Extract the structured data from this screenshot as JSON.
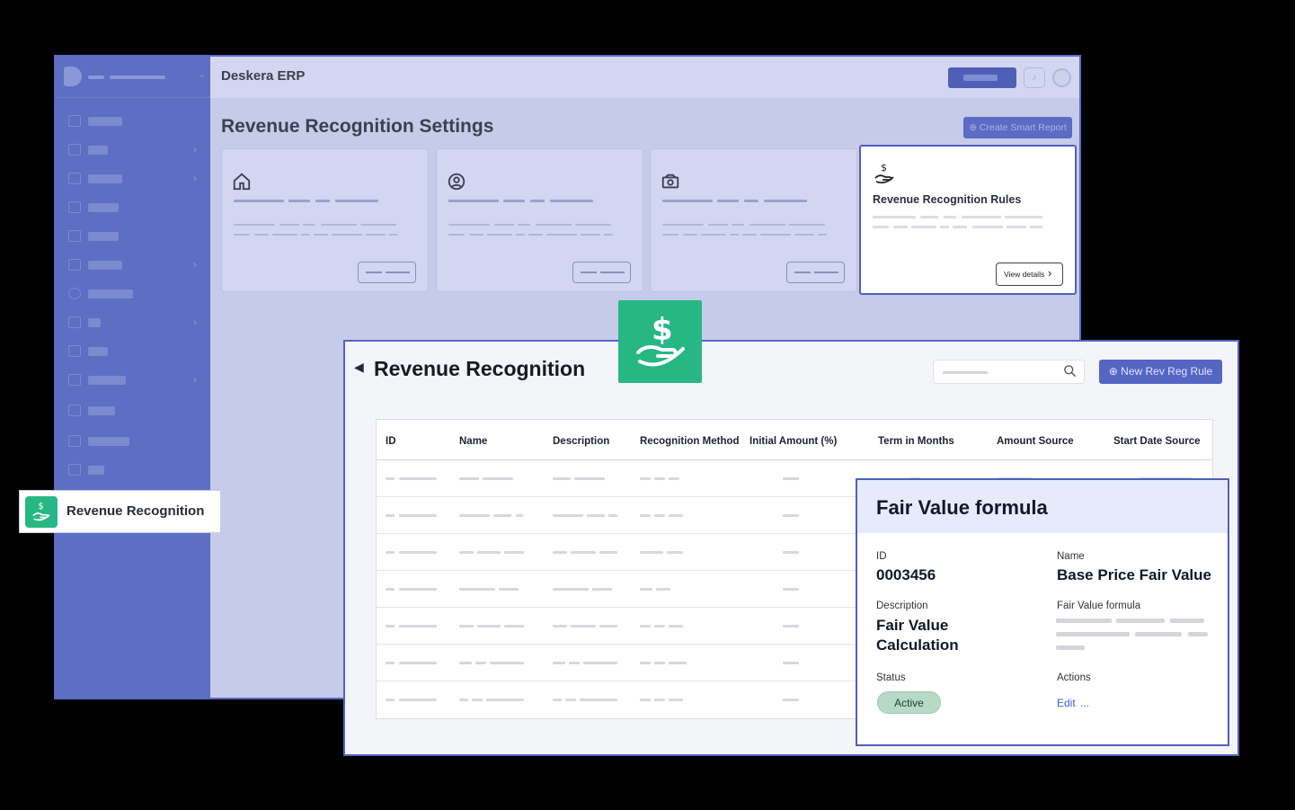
{
  "app": {
    "title": "Deskera ERP"
  },
  "settings": {
    "page_title": "Revenue Recognition Settings",
    "smart_report_label": "⊕ Create Smart Report",
    "active_card": {
      "title": "Revenue Recognition Rules",
      "button_label": "View details"
    }
  },
  "sidebar": {
    "highlighted": {
      "label": "Revenue Recognition"
    }
  },
  "revenue_recognition": {
    "title": "Revenue Recognition",
    "new_rule_label": "⊕  New Rev Reg  Rule",
    "columns": [
      "ID",
      "Name",
      "Description",
      "Recognition Method",
      "Initial Amount (%)",
      "Term in Months",
      "Amount Source",
      "Start Date Source"
    ]
  },
  "fair_value": {
    "title": "Fair Value formula",
    "id_label": "ID",
    "id_value": "0003456",
    "name_label": "Name",
    "name_value": "Base Price Fair Value",
    "description_label": "Description",
    "description_value_line1": "Fair Value",
    "description_value_line2": "Calculation",
    "formula_label": "Fair Value formula",
    "status_label": "Status",
    "status_value": "Active",
    "actions_label": "Actions",
    "edit_label": "Edit",
    "more_label": "..."
  },
  "icons": {
    "home": "home-icon",
    "user": "user-circle-icon",
    "money": "money-icon",
    "revenue": "hand-dollar-icon",
    "search": "search-icon",
    "back": "caret-left-icon",
    "bell": "bell-icon",
    "avatar": "avatar-icon"
  },
  "colors": {
    "brand": "#5e6ec2",
    "accent_green": "#26b784",
    "primary_button": "#5565c2",
    "status_active": "#b6dac6"
  }
}
